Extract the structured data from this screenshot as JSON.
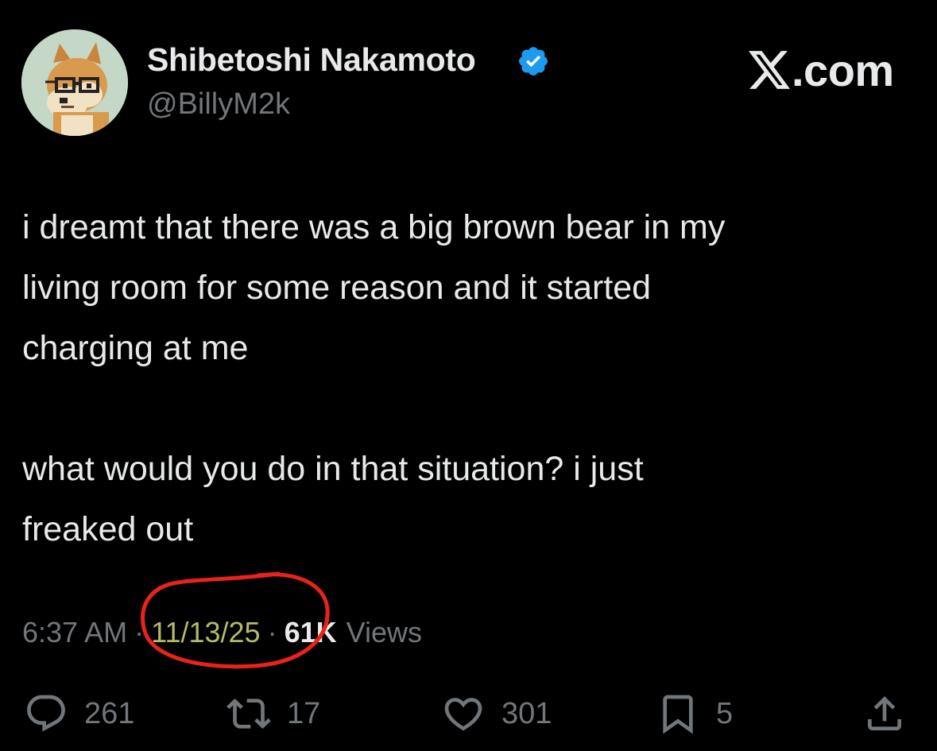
{
  "author": {
    "display_name": "Shibetoshi Nakamoto",
    "handle": "@BillyM2k",
    "verified": true
  },
  "brand": {
    "site_label": ".com"
  },
  "tweet": {
    "paragraphs": [
      [
        "i dreamt that there was a big brown bear in my",
        "living room for some reason and it started",
        "charging at me"
      ],
      [
        "what would you do in that situation? i just",
        "freaked out"
      ]
    ]
  },
  "meta": {
    "time": "6:37 AM",
    "separator": "·",
    "date": "11/13/25",
    "views_count": "61K",
    "views_label": "Views"
  },
  "actions": {
    "replies": "261",
    "reposts": "17",
    "likes": "301",
    "bookmarks": "5"
  },
  "colors": {
    "background": "#000000",
    "text": "#e7e9ea",
    "secondary": "#71767b",
    "verified": "#1d9bf0",
    "annotation": "#e8231c",
    "date_highlight": "#b7b96a"
  }
}
